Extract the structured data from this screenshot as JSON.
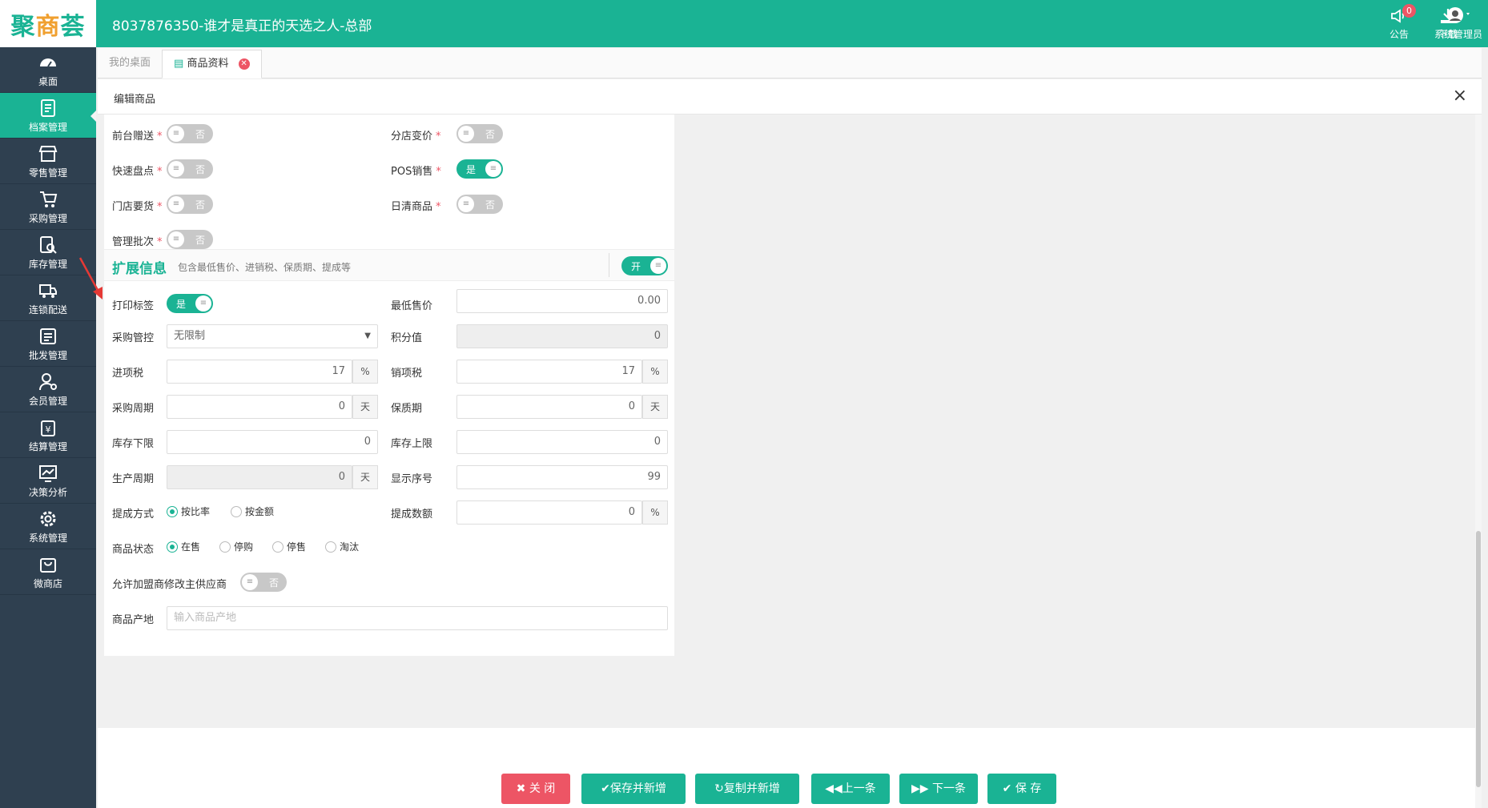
{
  "header": {
    "logo": "聚商荟",
    "store_title": "8037876350-谁才是真正的天选之人-总部",
    "notice_label": "公告",
    "notice_count": "0",
    "download_label": "下载",
    "user_label": "系统管理员"
  },
  "sidebar": {
    "items": [
      {
        "label": "桌面",
        "icon": "dashboard-icon"
      },
      {
        "label": "档案管理",
        "icon": "archive-icon",
        "active": true
      },
      {
        "label": "零售管理",
        "icon": "store-icon"
      },
      {
        "label": "采购管理",
        "icon": "cart-icon"
      },
      {
        "label": "库存管理",
        "icon": "inventory-icon"
      },
      {
        "label": "连锁配送",
        "icon": "truck-icon"
      },
      {
        "label": "批发管理",
        "icon": "wholesale-icon"
      },
      {
        "label": "会员管理",
        "icon": "member-icon"
      },
      {
        "label": "结算管理",
        "icon": "settlement-icon"
      },
      {
        "label": "决策分析",
        "icon": "chart-icon"
      },
      {
        "label": "系统管理",
        "icon": "gear-icon"
      },
      {
        "label": "微商店",
        "icon": "bag-icon"
      }
    ]
  },
  "tabs": {
    "desktop": "我的桌面",
    "product": "商品资料"
  },
  "panel": {
    "title": "编辑商品",
    "close": "×"
  },
  "toggles": {
    "front_gift": {
      "label": "前台赠送",
      "value": "否"
    },
    "branch_price": {
      "label": "分店变价",
      "value": "否"
    },
    "quick_count": {
      "label": "快速盘点",
      "value": "否"
    },
    "pos_sale": {
      "label": "POS销售",
      "value": "是"
    },
    "store_order": {
      "label": "门店要货",
      "value": "否"
    },
    "daily_clear": {
      "label": "日清商品",
      "value": "否"
    },
    "batch_manage": {
      "label": "管理批次",
      "value": "否"
    }
  },
  "extended": {
    "title": "扩展信息",
    "subtitle": "包含最低售价、进销税、保质期、提成等",
    "toggle_value": "开"
  },
  "fields": {
    "print_label": {
      "label": "打印标签",
      "value": "是"
    },
    "min_price": {
      "label": "最低售价",
      "value": "0.00"
    },
    "purchase_control": {
      "label": "采购管控",
      "value": "无限制"
    },
    "points": {
      "label": "积分值",
      "value": "0"
    },
    "input_tax": {
      "label": "进项税",
      "value": "17",
      "unit": "%"
    },
    "output_tax": {
      "label": "销项税",
      "value": "17",
      "unit": "%"
    },
    "purchase_cycle": {
      "label": "采购周期",
      "value": "0",
      "unit": "天"
    },
    "shelf_life": {
      "label": "保质期",
      "value": "0",
      "unit": "天"
    },
    "stock_min": {
      "label": "库存下限",
      "value": "0"
    },
    "stock_max": {
      "label": "库存上限",
      "value": "0"
    },
    "production_cycle": {
      "label": "生产周期",
      "value": "0",
      "unit": "天"
    },
    "display_order": {
      "label": "显示序号",
      "value": "99"
    },
    "commission_mode": {
      "label": "提成方式",
      "options": [
        "按比率",
        "按金额"
      ],
      "selected": "按比率"
    },
    "commission_value": {
      "label": "提成数额",
      "value": "0",
      "unit": "%"
    },
    "status": {
      "label": "商品状态",
      "options": [
        "在售",
        "停购",
        "停售",
        "淘汰"
      ],
      "selected": "在售"
    },
    "franchise_supplier": {
      "label": "允许加盟商修改主供应商",
      "value": "否"
    },
    "origin": {
      "label": "商品产地",
      "placeholder": "输入商品产地"
    }
  },
  "footer": {
    "close": "关 闭",
    "save_new": "保存并新增",
    "copy_new": "复制并新增",
    "prev": "上一条",
    "next": "下一条",
    "save": "保 存"
  },
  "colors": {
    "primary": "#1ab394",
    "danger": "#ed5565",
    "sidebar": "#2f4050"
  }
}
